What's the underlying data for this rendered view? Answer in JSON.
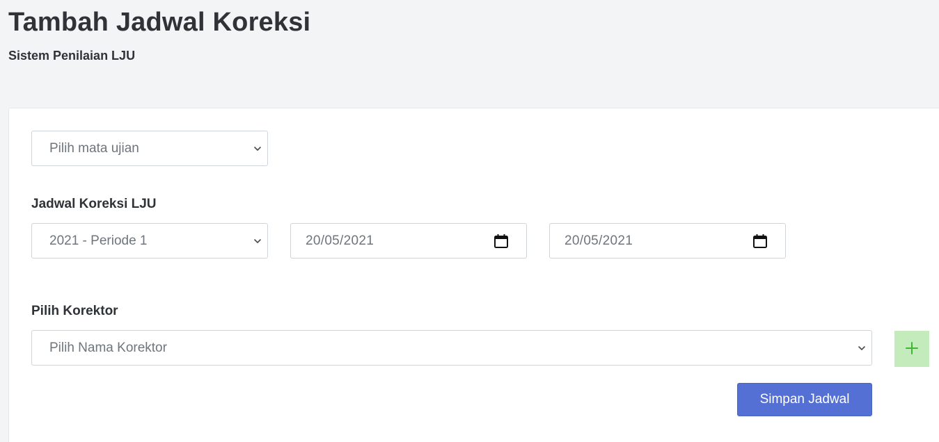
{
  "header": {
    "title": "Tambah Jadwal Koreksi",
    "subtitle": "Sistem Penilaian LJU"
  },
  "form": {
    "exam_select": {
      "selected": "Pilih mata ujian",
      "icon": "chevron-down-icon"
    },
    "schedule_label": "Jadwal Koreksi LJU",
    "period_select": {
      "selected": "2021 - Periode 1",
      "icon": "chevron-down-icon"
    },
    "start_date": {
      "value": "20/05/2021",
      "icon": "calendar-icon"
    },
    "end_date": {
      "value": "20/05/2021",
      "icon": "calendar-icon"
    },
    "corrector_label": "Pilih Korektor",
    "corrector_select": {
      "selected": "Pilih Nama Korektor",
      "icon": "chevron-down-icon"
    },
    "add_button": {
      "label": "+",
      "icon": "plus-icon"
    },
    "save_button": {
      "label": "Simpan Jadwal"
    }
  },
  "colors": {
    "page_background": "#f3f4f6",
    "card_background": "#ffffff",
    "primary": "#5470d5",
    "add_button_bg": "#c3ebbb",
    "add_button_fg": "#3fb531",
    "field_border": "#cfd4d9",
    "text_dark": "#2f3337",
    "text_muted": "#6e757c"
  }
}
